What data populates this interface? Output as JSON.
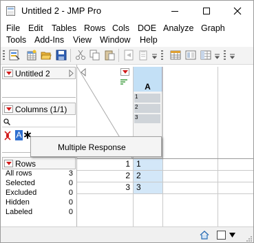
{
  "window": {
    "title": "Untitled 2 - JMP Pro"
  },
  "menu": [
    "File",
    "Edit",
    "Tables",
    "Rows",
    "Cols",
    "DOE",
    "Analyze",
    "Graph",
    "Tools",
    "Add-Ins",
    "View",
    "Window",
    "Help"
  ],
  "table_panel": {
    "title": "Untitled 2"
  },
  "columns_panel": {
    "title": "Columns (1/1)",
    "search_icon": "magnifier",
    "column_name": "A"
  },
  "rows_panel": {
    "title": "Rows",
    "items": [
      {
        "label": "All rows",
        "count": "3"
      },
      {
        "label": "Selected",
        "count": "0"
      },
      {
        "label": "Excluded",
        "count": "0"
      },
      {
        "label": "Hidden",
        "count": "0"
      },
      {
        "label": "Labeled",
        "count": "0"
      }
    ]
  },
  "grid": {
    "column_header": "A",
    "summary_values": [
      "1",
      "2",
      "3"
    ],
    "row_numbers": [
      "1",
      "2",
      "3"
    ],
    "cells": [
      "1",
      "2",
      "3"
    ]
  },
  "context_menu": {
    "items": [
      "Multiple Response"
    ]
  },
  "colors": {
    "selected_column": "#c3e0f6",
    "red_triangle": "#d21b1b"
  }
}
